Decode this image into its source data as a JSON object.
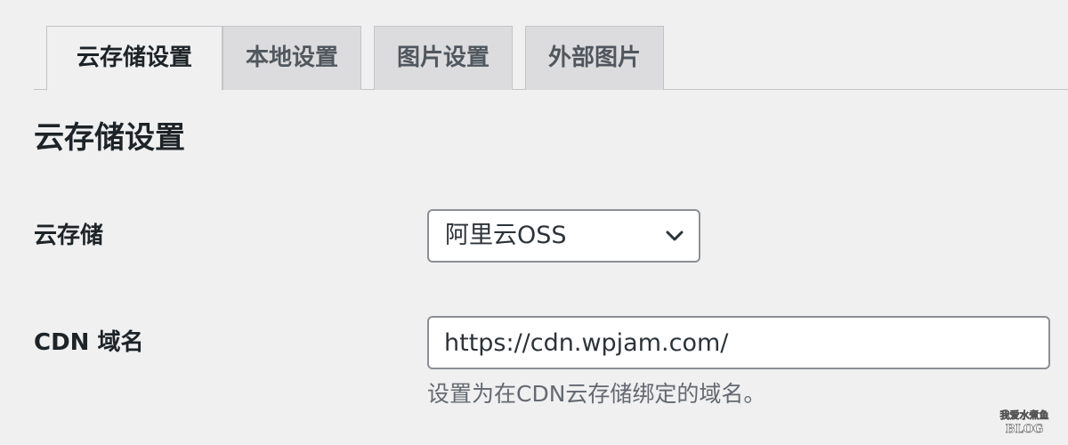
{
  "tabs": [
    {
      "label": "云存储设置",
      "active": true
    },
    {
      "label": "本地设置",
      "active": false
    },
    {
      "label": "图片设置",
      "active": false
    },
    {
      "label": "外部图片",
      "active": false
    }
  ],
  "section": {
    "title": "云存储设置"
  },
  "fields": {
    "cloud_storage": {
      "label": "云存储",
      "selected": "阿里云OSS",
      "icon": "chevron-down-icon"
    },
    "cdn_domain": {
      "label": "CDN 域名",
      "value": "https://cdn.wpjam.com/",
      "description": "设置为在CDN云存储绑定的域名。"
    }
  },
  "colors": {
    "background": "#f0f0f1",
    "tab_inactive": "#dcdcde",
    "border": "#c3c4c7",
    "input_border": "#8c8f94",
    "text": "#1d2327",
    "muted_text": "#646970"
  },
  "watermark": {
    "text": "我爱水煮鱼 BLOG"
  }
}
